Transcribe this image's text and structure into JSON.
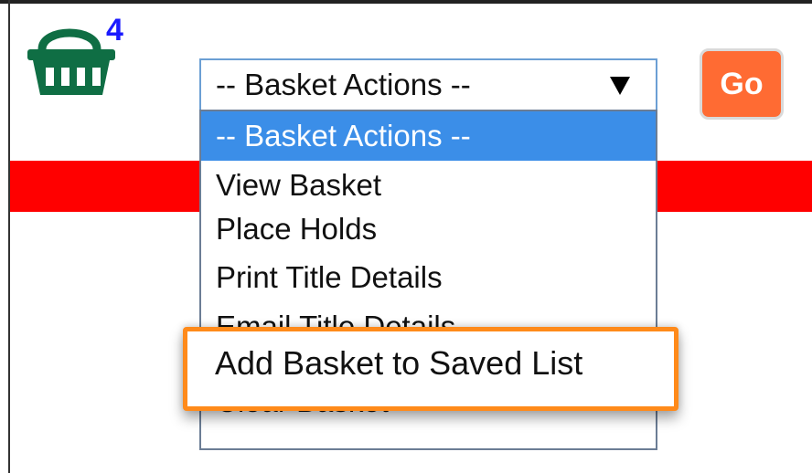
{
  "colors": {
    "accent_red": "#ff0000",
    "selected_bg": "#3b8ee8",
    "basket_green": "#0f6e44",
    "go_orange": "#ff6b33",
    "callout_orange": "#ff8a1a"
  },
  "basket": {
    "icon": "basket-icon",
    "count": "4"
  },
  "basket_actions": {
    "selected_value": "-- Basket Actions --",
    "options": [
      "-- Basket Actions --",
      "View Basket",
      "Place Holds",
      "Print Title Details",
      "Email Title Details",
      "Add Basket to Saved List",
      "Clear Basket"
    ],
    "highlighted_option": "Add Basket to Saved List"
  },
  "go_button": {
    "label": "Go"
  }
}
